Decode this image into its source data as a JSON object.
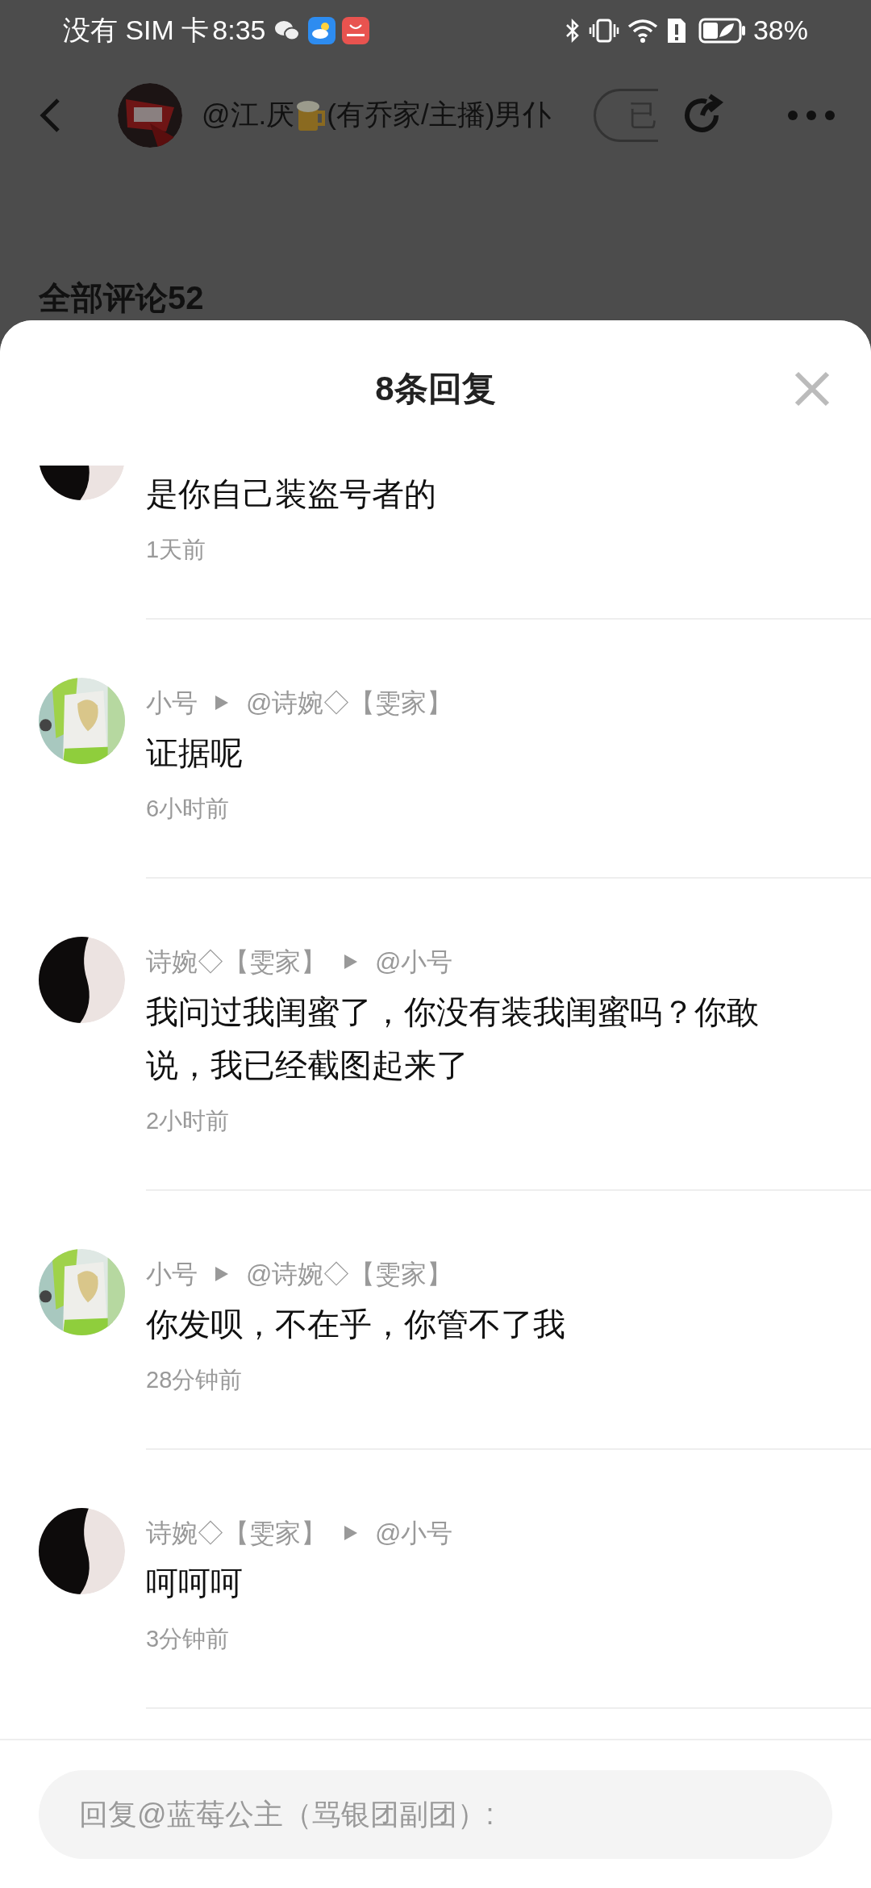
{
  "status_bar": {
    "carrier": "没有 SIM 卡",
    "time": "8:35",
    "battery": "38%"
  },
  "header": {
    "title_start": "@江.厌",
    "title_end": "(有乔家/主播)男仆",
    "follow_label": "已"
  },
  "section_title": "全部评论52",
  "sheet": {
    "title": "8条回复",
    "replies": [
      {
        "text": "是你自己装盗号者的",
        "time": "1天前"
      },
      {
        "author": "小号",
        "target": "@诗婉◇【雯家】",
        "text": "证据呢",
        "time": "6小时前"
      },
      {
        "author": "诗婉◇【雯家】",
        "target": "@小号",
        "text": "我问过我闺蜜了，你没有装我闺蜜吗？你敢说，我已经截图起来了",
        "time": "2小时前"
      },
      {
        "author": "小号",
        "target": "@诗婉◇【雯家】",
        "text": "你发呗，不在乎，你管不了我",
        "time": "28分钟前"
      },
      {
        "author": "诗婉◇【雯家】",
        "target": "@小号",
        "text": "呵呵呵",
        "time": "3分钟前"
      }
    ],
    "reply_box": {
      "placeholder": "回复@蓝莓公主（骂银团副团）:"
    }
  }
}
